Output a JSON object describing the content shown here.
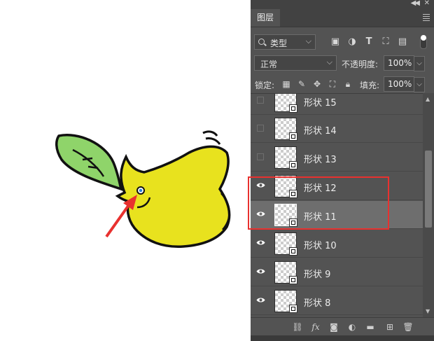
{
  "panel": {
    "tab_label": "图层",
    "filter": {
      "kind_label": "类型"
    },
    "blend": {
      "mode": "正常",
      "opacity_label": "不透明度:",
      "opacity_value": "100%"
    },
    "lock": {
      "label": "锁定:",
      "fill_label": "填充:",
      "fill_value": "100%"
    },
    "layers": [
      {
        "name": "形状 15",
        "visible": false,
        "selected": false
      },
      {
        "name": "形状 14",
        "visible": false,
        "selected": false
      },
      {
        "name": "形状 13",
        "visible": false,
        "selected": false
      },
      {
        "name": "形状 12",
        "visible": true,
        "selected": false
      },
      {
        "name": "形状 11",
        "visible": true,
        "selected": true
      },
      {
        "name": "形状 10",
        "visible": true,
        "selected": false
      },
      {
        "name": "形状 9",
        "visible": true,
        "selected": false
      },
      {
        "name": "形状 8",
        "visible": true,
        "selected": false
      }
    ]
  },
  "icons": {
    "eye": "eye-icon",
    "link": "link-icon",
    "fx": "fx-icon",
    "mask": "mask-icon",
    "adjustment": "adjustment-icon",
    "group": "folder-icon",
    "new_layer": "new-layer-icon",
    "delete": "trash-icon"
  },
  "colors": {
    "panel_bg": "#535353",
    "selected_row": "#6e6e6e",
    "highlight": "#e8312f",
    "bird_body": "#e8e21e",
    "leaf": "#8fd46a",
    "arrow": "#e8312f"
  }
}
